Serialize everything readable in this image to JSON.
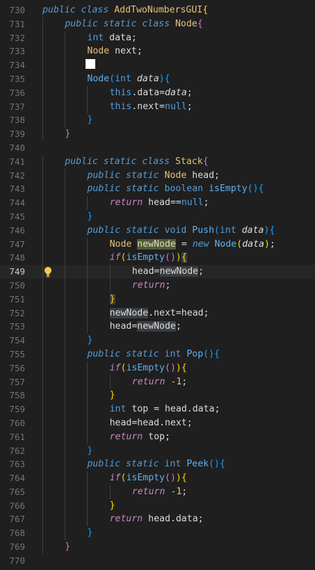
{
  "editor": {
    "current_line": 749,
    "lines": [
      {
        "n": "730",
        "indent": 0,
        "tokens": [
          {
            "t": "public class ",
            "c": "kwi"
          },
          {
            "t": "AddTwoNumbersGUI",
            "c": "cls"
          },
          {
            "t": "{",
            "c": "b1"
          }
        ]
      },
      {
        "n": "731",
        "indent": 1,
        "tokens": [
          {
            "t": "public static class ",
            "c": "kwi"
          },
          {
            "t": "Node",
            "c": "cls"
          },
          {
            "t": "{",
            "c": "b2"
          }
        ]
      },
      {
        "n": "732",
        "indent": 2,
        "tokens": [
          {
            "t": "int ",
            "c": "kw"
          },
          {
            "t": "data",
            "c": "id"
          },
          {
            "t": ";",
            "c": "punc"
          }
        ]
      },
      {
        "n": "733",
        "indent": 2,
        "tokens": [
          {
            "t": "Node ",
            "c": "cls"
          },
          {
            "t": "next",
            "c": "id"
          },
          {
            "t": ";",
            "c": "punc"
          }
        ]
      },
      {
        "n": "734",
        "indent": 2,
        "tokens": [
          {
            "t": " ",
            "c": "cursor"
          }
        ]
      },
      {
        "n": "735",
        "indent": 2,
        "tokens": [
          {
            "t": "Node",
            "c": "fn"
          },
          {
            "t": "(",
            "c": "b3"
          },
          {
            "t": "int ",
            "c": "kw"
          },
          {
            "t": "data",
            "c": "param"
          },
          {
            "t": ")",
            "c": "b3"
          },
          {
            "t": "{",
            "c": "b3"
          }
        ]
      },
      {
        "n": "736",
        "indent": 3,
        "tokens": [
          {
            "t": "this",
            "c": "kw"
          },
          {
            "t": ".data=",
            "c": "id"
          },
          {
            "t": "data",
            "c": "param"
          },
          {
            "t": ";",
            "c": "punc"
          }
        ]
      },
      {
        "n": "737",
        "indent": 3,
        "tokens": [
          {
            "t": "this",
            "c": "kw"
          },
          {
            "t": ".next=",
            "c": "id"
          },
          {
            "t": "null",
            "c": "kw"
          },
          {
            "t": ";",
            "c": "punc"
          }
        ]
      },
      {
        "n": "738",
        "indent": 2,
        "tokens": [
          {
            "t": "}",
            "c": "b3"
          }
        ]
      },
      {
        "n": "739",
        "indent": 1,
        "tokens": [
          {
            "t": "}",
            "c": "b2"
          }
        ]
      },
      {
        "n": "740",
        "indent": 0,
        "tokens": []
      },
      {
        "n": "741",
        "indent": 1,
        "tokens": [
          {
            "t": "public static class ",
            "c": "kwi"
          },
          {
            "t": "Stack",
            "c": "cls"
          },
          {
            "t": "{",
            "c": "b2"
          }
        ]
      },
      {
        "n": "742",
        "indent": 2,
        "tokens": [
          {
            "t": "public static ",
            "c": "kwi"
          },
          {
            "t": "Node ",
            "c": "cls"
          },
          {
            "t": "head",
            "c": "id"
          },
          {
            "t": ";",
            "c": "punc"
          }
        ]
      },
      {
        "n": "743",
        "indent": 2,
        "tokens": [
          {
            "t": "public static ",
            "c": "kwi"
          },
          {
            "t": "boolean ",
            "c": "kw"
          },
          {
            "t": "isEmpty",
            "c": "fn"
          },
          {
            "t": "()",
            "c": "b3"
          },
          {
            "t": "{",
            "c": "b3"
          }
        ]
      },
      {
        "n": "744",
        "indent": 3,
        "tokens": [
          {
            "t": "return ",
            "c": "ctl"
          },
          {
            "t": "head==",
            "c": "id"
          },
          {
            "t": "null",
            "c": "kw"
          },
          {
            "t": ";",
            "c": "punc"
          }
        ]
      },
      {
        "n": "745",
        "indent": 2,
        "tokens": [
          {
            "t": "}",
            "c": "b3"
          }
        ]
      },
      {
        "n": "746",
        "indent": 2,
        "tokens": [
          {
            "t": "public static ",
            "c": "kwi"
          },
          {
            "t": "void ",
            "c": "kw"
          },
          {
            "t": "Push",
            "c": "fn"
          },
          {
            "t": "(",
            "c": "b3"
          },
          {
            "t": "int ",
            "c": "kw"
          },
          {
            "t": "data",
            "c": "param"
          },
          {
            "t": ")",
            "c": "b3"
          },
          {
            "t": "{",
            "c": "b3"
          }
        ]
      },
      {
        "n": "747",
        "indent": 3,
        "tokens": [
          {
            "t": "Node ",
            "c": "cls"
          },
          {
            "t": "newNode",
            "c": "id",
            "hl": "strong"
          },
          {
            "t": " = ",
            "c": "punc"
          },
          {
            "t": "new ",
            "c": "kwi"
          },
          {
            "t": "Node",
            "c": "fn"
          },
          {
            "t": "(",
            "c": "b1"
          },
          {
            "t": "data",
            "c": "param"
          },
          {
            "t": ")",
            "c": "b1"
          },
          {
            "t": ";",
            "c": "punc"
          }
        ]
      },
      {
        "n": "748",
        "indent": 3,
        "tokens": [
          {
            "t": "if",
            "c": "ctl"
          },
          {
            "t": "(",
            "c": "b1"
          },
          {
            "t": "isEmpty",
            "c": "fn"
          },
          {
            "t": "()",
            "c": "b2"
          },
          {
            "t": ")",
            "c": "b1"
          },
          {
            "t": "{",
            "c": "b1",
            "hl": "soft"
          }
        ]
      },
      {
        "n": "749",
        "indent": 4,
        "tokens": [
          {
            "t": "head=",
            "c": "id"
          },
          {
            "t": "newNode",
            "c": "id",
            "hl": "soft"
          },
          {
            "t": ";",
            "c": "punc"
          }
        ]
      },
      {
        "n": "750",
        "indent": 4,
        "tokens": [
          {
            "t": "return",
            "c": "ctl"
          },
          {
            "t": ";",
            "c": "punc"
          }
        ]
      },
      {
        "n": "751",
        "indent": 3,
        "tokens": [
          {
            "t": "}",
            "c": "b1",
            "hl": "soft"
          }
        ]
      },
      {
        "n": "752",
        "indent": 3,
        "tokens": [
          {
            "t": "newNode",
            "c": "id",
            "hl": "soft"
          },
          {
            "t": ".next=head;",
            "c": "id"
          }
        ]
      },
      {
        "n": "753",
        "indent": 3,
        "tokens": [
          {
            "t": "head=",
            "c": "id"
          },
          {
            "t": "newNode",
            "c": "id",
            "hl": "soft"
          },
          {
            "t": ";",
            "c": "punc"
          }
        ]
      },
      {
        "n": "754",
        "indent": 2,
        "tokens": [
          {
            "t": "}",
            "c": "b3"
          }
        ]
      },
      {
        "n": "755",
        "indent": 2,
        "tokens": [
          {
            "t": "public static ",
            "c": "kwi"
          },
          {
            "t": "int ",
            "c": "kw"
          },
          {
            "t": "Pop",
            "c": "fn"
          },
          {
            "t": "()",
            "c": "b3"
          },
          {
            "t": "{",
            "c": "b3"
          }
        ]
      },
      {
        "n": "756",
        "indent": 3,
        "tokens": [
          {
            "t": "if",
            "c": "ctl"
          },
          {
            "t": "(",
            "c": "b1"
          },
          {
            "t": "isEmpty",
            "c": "fn"
          },
          {
            "t": "()",
            "c": "b2"
          },
          {
            "t": ")",
            "c": "b1"
          },
          {
            "t": "{",
            "c": "b1"
          }
        ]
      },
      {
        "n": "757",
        "indent": 4,
        "tokens": [
          {
            "t": "return ",
            "c": "ctl"
          },
          {
            "t": "-1",
            "c": "num"
          },
          {
            "t": ";",
            "c": "punc"
          }
        ]
      },
      {
        "n": "758",
        "indent": 3,
        "tokens": [
          {
            "t": "}",
            "c": "b1"
          }
        ]
      },
      {
        "n": "759",
        "indent": 3,
        "tokens": [
          {
            "t": "int ",
            "c": "kw"
          },
          {
            "t": "top = head.data;",
            "c": "id"
          }
        ]
      },
      {
        "n": "760",
        "indent": 3,
        "tokens": [
          {
            "t": "head=head.next;",
            "c": "id"
          }
        ]
      },
      {
        "n": "761",
        "indent": 3,
        "tokens": [
          {
            "t": "return ",
            "c": "ctl"
          },
          {
            "t": "top;",
            "c": "id"
          }
        ]
      },
      {
        "n": "762",
        "indent": 2,
        "tokens": [
          {
            "t": "}",
            "c": "b3"
          }
        ]
      },
      {
        "n": "763",
        "indent": 2,
        "tokens": [
          {
            "t": "public static ",
            "c": "kwi"
          },
          {
            "t": "int ",
            "c": "kw"
          },
          {
            "t": "Peek",
            "c": "fn"
          },
          {
            "t": "()",
            "c": "b3"
          },
          {
            "t": "{",
            "c": "b3"
          }
        ]
      },
      {
        "n": "764",
        "indent": 3,
        "tokens": [
          {
            "t": "if",
            "c": "ctl"
          },
          {
            "t": "(",
            "c": "b1"
          },
          {
            "t": "isEmpty",
            "c": "fn"
          },
          {
            "t": "()",
            "c": "b2"
          },
          {
            "t": ")",
            "c": "b1"
          },
          {
            "t": "{",
            "c": "b1"
          }
        ]
      },
      {
        "n": "765",
        "indent": 4,
        "tokens": [
          {
            "t": "return ",
            "c": "ctl"
          },
          {
            "t": "-1",
            "c": "num"
          },
          {
            "t": ";",
            "c": "punc"
          }
        ]
      },
      {
        "n": "766",
        "indent": 3,
        "tokens": [
          {
            "t": "}",
            "c": "b1"
          }
        ]
      },
      {
        "n": "767",
        "indent": 3,
        "tokens": [
          {
            "t": "return ",
            "c": "ctl"
          },
          {
            "t": "head.data;",
            "c": "id"
          }
        ]
      },
      {
        "n": "768",
        "indent": 2,
        "tokens": [
          {
            "t": "}",
            "c": "b3"
          }
        ]
      },
      {
        "n": "769",
        "indent": 1,
        "tokens": [
          {
            "t": "}",
            "c": "b2"
          }
        ]
      },
      {
        "n": "770",
        "indent": 0,
        "tokens": []
      }
    ]
  },
  "lightbulb_icon": "lightbulb-icon",
  "colors": {
    "background": "#1f1f1f",
    "current_line": "#262626",
    "line_number": "#6e7681",
    "lightbulb": "#f2c94c"
  }
}
